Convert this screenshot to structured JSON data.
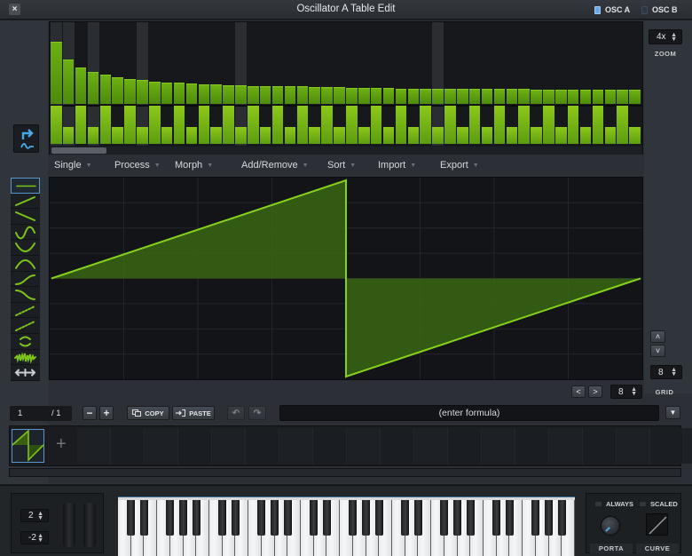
{
  "window": {
    "title": "Oscillator A Table Edit",
    "close_label": "×",
    "osc_tabs": [
      {
        "label": "OSC A",
        "active": true
      },
      {
        "label": "OSC B",
        "active": false
      }
    ]
  },
  "harmonics": {
    "count": 48,
    "highlighted_harmonics": [
      1,
      2,
      4,
      8,
      16,
      32
    ],
    "amplitudes": [
      1.0,
      0.71,
      0.59,
      0.52,
      0.47,
      0.43,
      0.4,
      0.38,
      0.36,
      0.35,
      0.34,
      0.33,
      0.32,
      0.31,
      0.3,
      0.3,
      0.29,
      0.29,
      0.28,
      0.28,
      0.28,
      0.27,
      0.27,
      0.27,
      0.26,
      0.26,
      0.26,
      0.26,
      0.25,
      0.25,
      0.25,
      0.25,
      0.25,
      0.24,
      0.24,
      0.24,
      0.24,
      0.24,
      0.24,
      0.23,
      0.23,
      0.23,
      0.23,
      0.23,
      0.23,
      0.23,
      0.23,
      0.23
    ],
    "phases_pattern": "alternating full / low",
    "scroll_position": 0.0
  },
  "zoom": {
    "value": "4x",
    "label": "ZOOM"
  },
  "mode_button": {
    "icon": "redirect-wave-icon"
  },
  "menus": [
    {
      "label": "Single"
    },
    {
      "label": "Process"
    },
    {
      "label": "Morph"
    },
    {
      "label": "Add/Remove"
    },
    {
      "label": "Sort"
    },
    {
      "label": "Import"
    },
    {
      "label": "Export"
    }
  ],
  "shapes": [
    {
      "name": "flat-line",
      "selected": true
    },
    {
      "name": "ramp-up"
    },
    {
      "name": "ramp-down"
    },
    {
      "name": "sine"
    },
    {
      "name": "concave-up"
    },
    {
      "name": "concave-down"
    },
    {
      "name": "ease-in"
    },
    {
      "name": "ease-out"
    },
    {
      "name": "steps-up-fine"
    },
    {
      "name": "steps-up-coarse"
    },
    {
      "name": "pinch"
    },
    {
      "name": "noise"
    },
    {
      "name": "stretch"
    }
  ],
  "waveform": {
    "type": "saw",
    "points": [
      [
        0,
        0
      ],
      [
        0.5,
        1
      ],
      [
        0.5,
        -1
      ],
      [
        1,
        0
      ]
    ],
    "grid_columns": 8,
    "grid_rows": 8
  },
  "graph_controls": {
    "up_label": "˄",
    "down_label": "˅",
    "grid_value": "8",
    "grid_label": "GRID",
    "prev_label": "<",
    "next_label": ">",
    "snap_value": "8"
  },
  "frame": {
    "current": "1",
    "total": "/ 1",
    "minus_label": "−",
    "plus_label": "+",
    "copy_label": "COPY",
    "paste_label": "PASTE",
    "undo_label": "↶",
    "redo_label": "↷",
    "formula_placeholder": "(enter formula)",
    "formula_menu_label": "▼",
    "add_frame_label": "+"
  },
  "keyboard": {
    "pitch_up": "2",
    "pitch_down": "-2",
    "white_keys": 35,
    "always_label": "ALWAYS",
    "scaled_label": "SCALED",
    "porta_label": "PORTA",
    "curve_label": "CURVE"
  },
  "colors": {
    "accent_green": "#7cc41a",
    "accent_blue": "#5b95c9",
    "background": "#2c3036"
  }
}
